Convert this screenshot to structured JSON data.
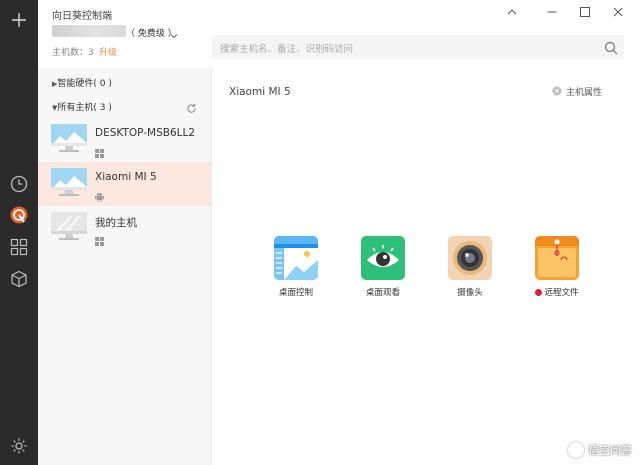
{
  "app": {
    "title": "向日葵控制端",
    "window_controls": [
      "minimize",
      "maximize",
      "close"
    ]
  },
  "account": {
    "plan_label": "（ 免费级 ）",
    "host_count_label": "主机数：",
    "host_count": "3",
    "upgrade_label": "升级"
  },
  "search": {
    "placeholder": "搜索主机名、备注、识别码访问"
  },
  "rail": {
    "items": [
      {
        "icon": "plus-icon"
      },
      {
        "icon": "history-clock-icon"
      },
      {
        "icon": "sunlogin-remote-icon"
      },
      {
        "icon": "grid-apps-icon"
      },
      {
        "icon": "cube-icon"
      },
      {
        "icon": "settings-gear-icon"
      }
    ]
  },
  "sidebar": {
    "smart_hw_label": "智能硬件",
    "smart_hw_count": "( 0 )",
    "all_hosts_label": "所有主机",
    "all_hosts_count": "( 3 )",
    "hosts": [
      {
        "name": "DESKTOP-MSB6LL2",
        "os": "windows-icon",
        "online": true,
        "active": false
      },
      {
        "name": "Xiaomi MI 5",
        "os": "android-icon",
        "online": true,
        "active": true
      },
      {
        "name": "我的主机",
        "os": "windows-icon",
        "online": false,
        "active": false
      }
    ]
  },
  "main": {
    "title": "Xiaomi MI 5",
    "props_label": "主机属性",
    "features": [
      {
        "label": "桌面控制",
        "color": "#1e90e8",
        "icon": "desktop-control-icon"
      },
      {
        "label": "桌面观看",
        "color": "#2cc07a",
        "icon": "desktop-view-eye-icon"
      },
      {
        "label": "摄像头",
        "color": "#e9b87f",
        "icon": "camera-icon"
      },
      {
        "label": "远程文件",
        "color": "#f5a333",
        "icon": "remote-file-icon"
      }
    ]
  },
  "watermark": {
    "text": "悟空问答"
  },
  "colors": {
    "accent": "#f08a3c",
    "active_row": "#fde8df",
    "rail": "#2b2b2b"
  }
}
